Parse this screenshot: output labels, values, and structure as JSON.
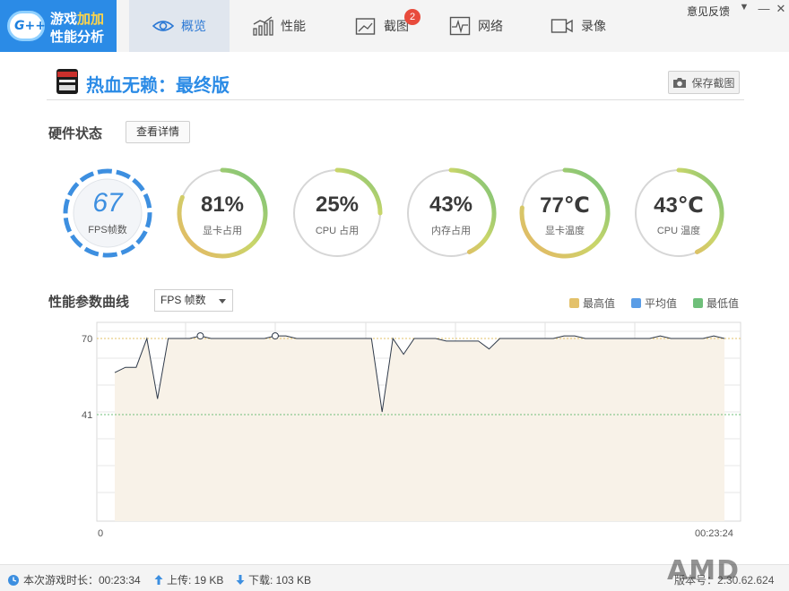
{
  "app": {
    "name_line1_a": "游戏",
    "name_line1_b": "加加",
    "name_line2": "性能分析",
    "logo_badge": "G++"
  },
  "tabs": [
    {
      "label": "概览",
      "icon": "eye-icon",
      "active": true
    },
    {
      "label": "性能",
      "icon": "bar-chart-icon"
    },
    {
      "label": "截图",
      "icon": "image-icon",
      "badge": "2"
    },
    {
      "label": "网络",
      "icon": "pulse-icon"
    },
    {
      "label": "录像",
      "icon": "video-camera-icon"
    }
  ],
  "window": {
    "feedback": "意见反馈",
    "menu": "▼",
    "minimize": "—",
    "close": "✕"
  },
  "game": {
    "title": "热血无赖：最终版",
    "save_screenshot": "保存截图"
  },
  "hardware": {
    "title": "硬件状态",
    "detail_button": "查看详情",
    "fps": {
      "value": "67",
      "label": "FPS帧数"
    },
    "gauges": [
      {
        "value": "81%",
        "label": "显卡占用",
        "percent": 81
      },
      {
        "value": "25%",
        "label": "CPU 占用",
        "percent": 25
      },
      {
        "value": "43%",
        "label": "内存占用",
        "percent": 43
      },
      {
        "value": "77℃",
        "label": "显卡温度",
        "percent": 77
      },
      {
        "value": "43℃",
        "label": "CPU 温度",
        "percent": 43
      }
    ]
  },
  "curve": {
    "title": "性能参数曲线",
    "metric_select": "FPS 帧数",
    "legend": [
      {
        "label": "最高值",
        "color": "#e3c16a"
      },
      {
        "label": "平均值",
        "color": "#5a9de6"
      },
      {
        "label": "最低值",
        "color": "#6fbf7a"
      }
    ]
  },
  "chart_data": {
    "type": "line",
    "series": [
      {
        "values": [
          57,
          59,
          59,
          70,
          47,
          70,
          70,
          70,
          71,
          70,
          70,
          70,
          70,
          70,
          70,
          71,
          71,
          70,
          70,
          70,
          70,
          70,
          70,
          70,
          70,
          42,
          70,
          64,
          70,
          70,
          70,
          69,
          69,
          69,
          69,
          66,
          70,
          70,
          70,
          70,
          70,
          70,
          71,
          71,
          70,
          70,
          70,
          70,
          70,
          70,
          70,
          71,
          70,
          70,
          70,
          70,
          71,
          70
        ]
      }
    ],
    "reference_lines": {
      "max": 70,
      "min": 41
    },
    "y_ticks": [
      "70",
      "41"
    ],
    "x_start_label": "0",
    "x_end_label": "00:23:24"
  },
  "status": {
    "session_time": "本次游戏时长：00:23:34",
    "upload": "上传: 19 KB",
    "download": "下载: 103 KB",
    "version": "版本号：2.30.62.624",
    "brand": "AMD"
  }
}
